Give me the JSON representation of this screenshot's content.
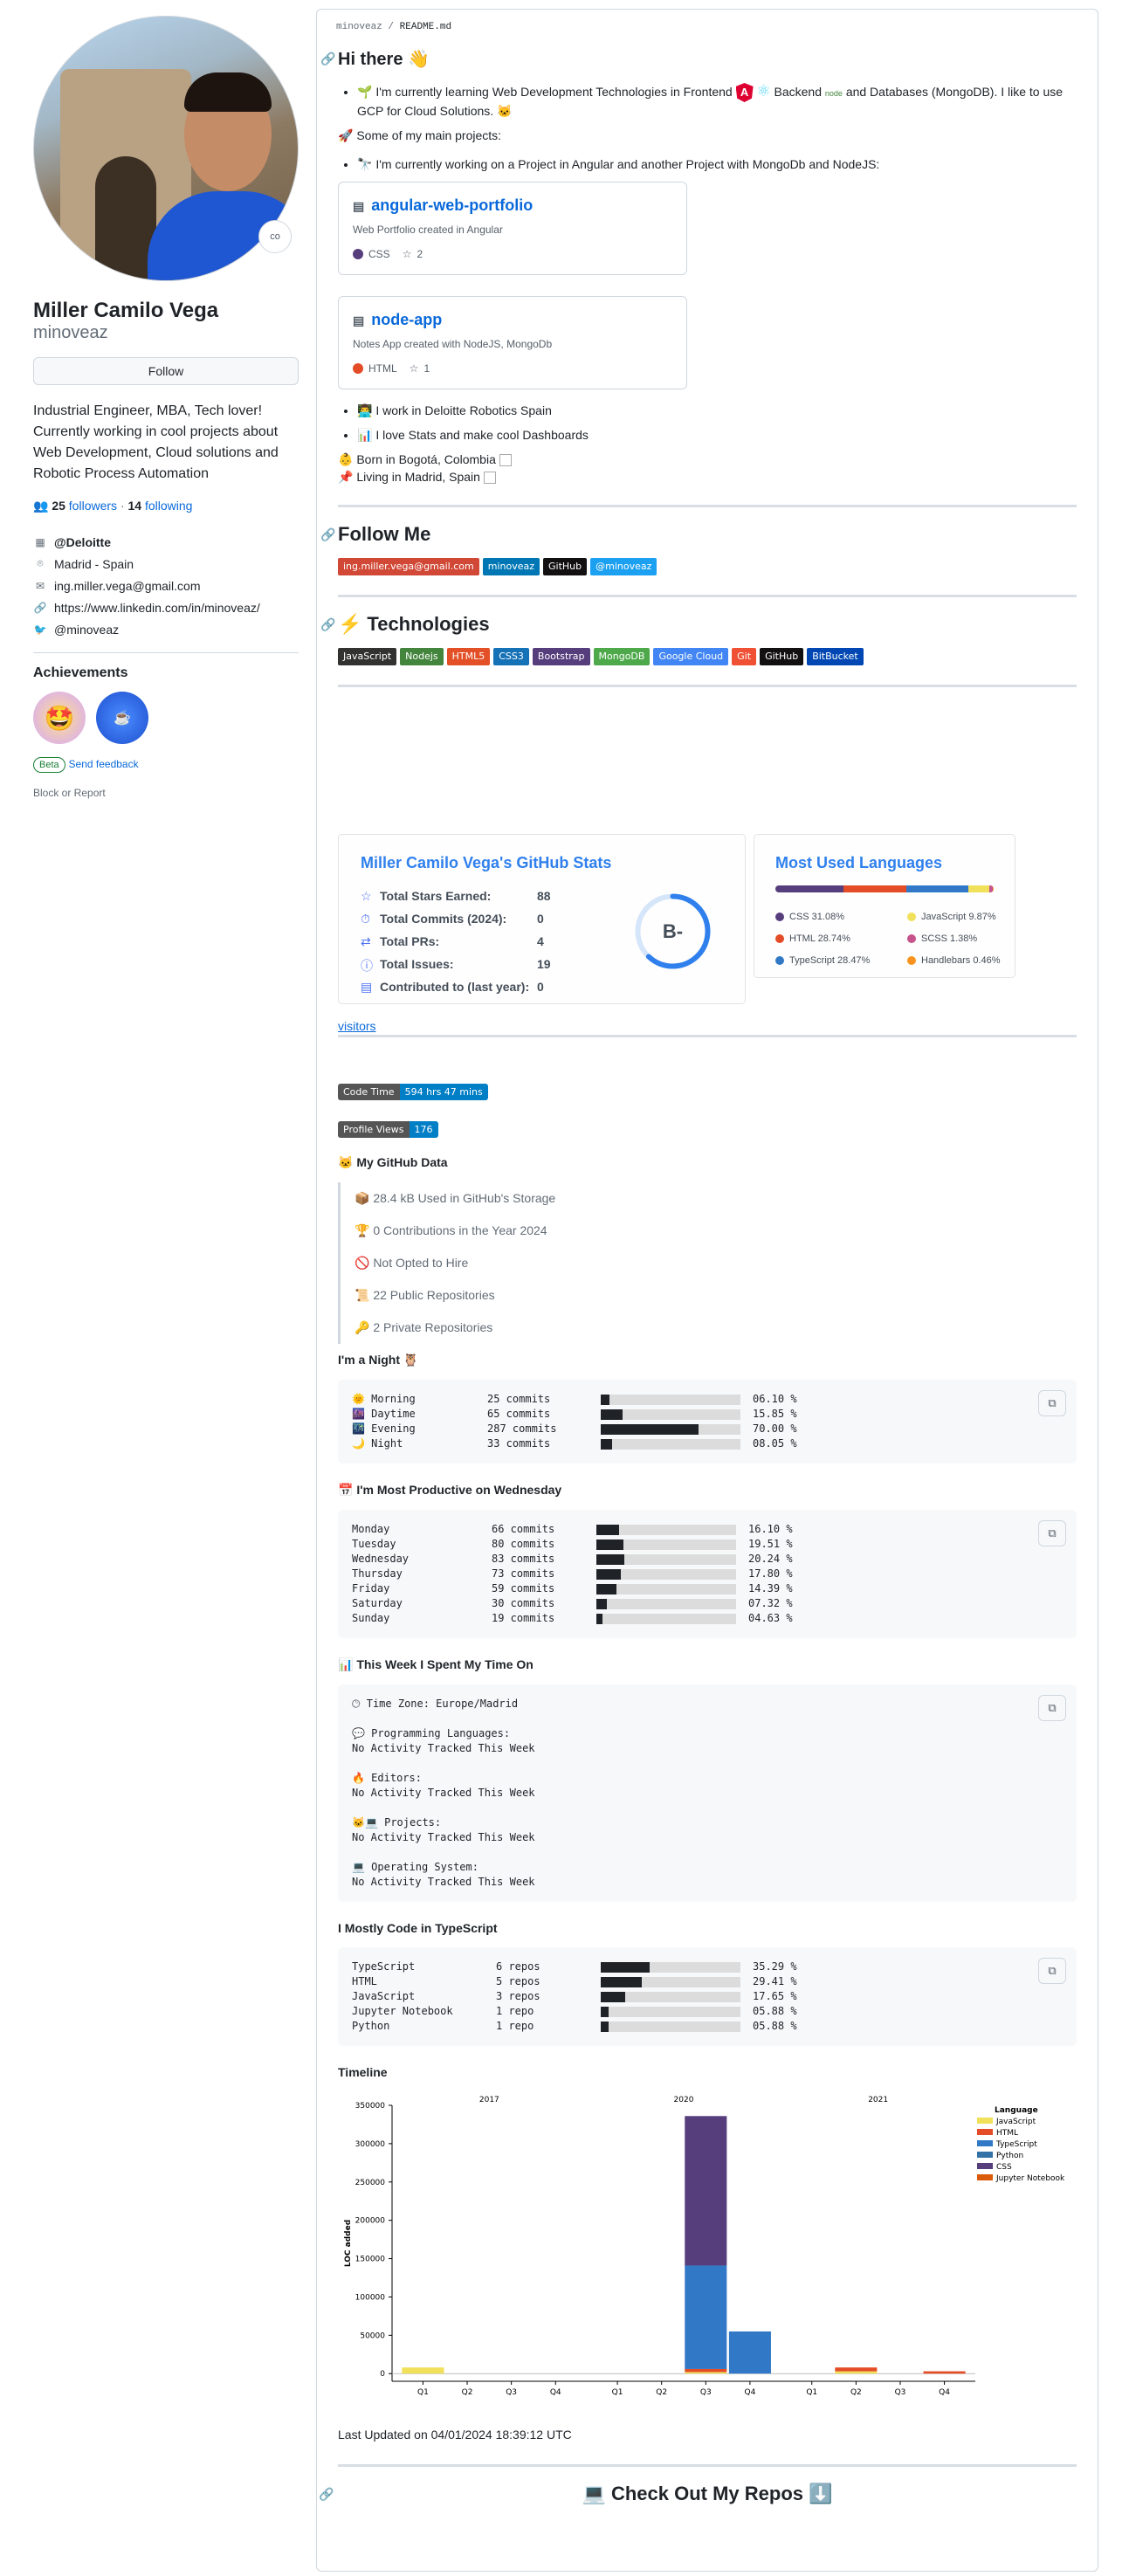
{
  "profile": {
    "name": "Miller Camilo Vega",
    "login": "minoveaz",
    "status_emoji": "co",
    "follow_label": "Follow",
    "bio": "Industrial Engineer, MBA, Tech lover! Currently working in cool projects about Web Development, Cloud solutions and Robotic Process Automation",
    "followers": "25",
    "followers_label": "followers",
    "dot": "·",
    "following": "14",
    "following_label": "following",
    "company": "@Deloitte",
    "location": "Madrid - Spain",
    "email": "ing.miller.vega@gmail.com",
    "website": "https://www.linkedin.com/in/minoveaz/",
    "twitter": "@minoveaz",
    "achievements_title": "Achievements",
    "beta_label": "Beta",
    "feedback_label": "Send feedback",
    "block_label": "Block or Report"
  },
  "readme": {
    "breadcrumb_user": "minoveaz",
    "breadcrumb_sep": "/",
    "breadcrumb_file": "README.md",
    "hi_title": "Hi there 👋",
    "learning_1": "🌱 I'm currently learning Web Development Technologies in Frontend",
    "learning_2": "Backend",
    "learning_3": "and Databases (MongoDB). I like to use GCP for Cloud Solutions.",
    "projects_intro": "🚀 Some of my main projects:",
    "working_on": "🔭 I'm currently working on a Project in Angular and another Project with MongoDb and NodeJS:",
    "repos": [
      {
        "name": "angular-web-portfolio",
        "desc": "Web Portfolio created in Angular",
        "lang": "CSS",
        "lang_color": "#563d7c",
        "stars": "2"
      },
      {
        "name": "node-app",
        "desc": "Notes App created with NodeJS, MongoDb",
        "lang": "HTML",
        "lang_color": "#e34c26",
        "stars": "1"
      }
    ],
    "work": "👨‍💻 I work in Deloitte Robotics Spain",
    "love": "📊 I love Stats and make cool Dashboards",
    "born": "👶 Born in Bogotá, Colombia",
    "living": "📌 Living in Madrid, Spain",
    "follow_title": "Follow Me",
    "follow_badges": [
      {
        "label": "ing.miller.vega@gmail.com",
        "color": "#d14836"
      },
      {
        "label": "minoveaz",
        "color": "#0077b5"
      },
      {
        "label": "GitHub",
        "color": "#121011"
      },
      {
        "label": "@minoveaz",
        "color": "#1ca0f1"
      }
    ],
    "tech_title": "Technologies",
    "tech_badges": [
      {
        "label": "JavaScript",
        "color": "#323330"
      },
      {
        "label": "Nodejs",
        "color": "#43853d"
      },
      {
        "label": "HTML5",
        "color": "#e34f26"
      },
      {
        "label": "CSS3",
        "color": "#1572b6"
      },
      {
        "label": "Bootstrap",
        "color": "#563d7c"
      },
      {
        "label": "MongoDB",
        "color": "#4ea94b"
      },
      {
        "label": "Google Cloud",
        "color": "#4285f4"
      },
      {
        "label": "Git",
        "color": "#f05033"
      },
      {
        "label": "GitHub",
        "color": "#121011"
      },
      {
        "label": "BitBucket",
        "color": "#0047b3"
      }
    ],
    "visitors_alt": "visitors",
    "code_time_label": "Code Time",
    "code_time_value": "594 hrs 47 mins",
    "profile_views_label": "Profile Views",
    "profile_views_value": "176",
    "gh_data_title": "🐱 My GitHub Data",
    "gh_data": [
      "📦 28.4 kB Used in GitHub's Storage",
      "🏆 0 Contributions in the Year 2024",
      "🚫 Not Opted to Hire",
      "📜 22 Public Repositories",
      "🔑 2 Private Repositories"
    ],
    "night_title": "I'm a Night 🦉",
    "night_rows": [
      {
        "label": "🌞 Morning",
        "commits": "25 commits",
        "pct": "06.10 %",
        "val": 6.1
      },
      {
        "label": "🌆 Daytime",
        "commits": "65 commits",
        "pct": "15.85 %",
        "val": 15.85
      },
      {
        "label": "🌃 Evening",
        "commits": "287 commits",
        "pct": "70.00 %",
        "val": 70.0
      },
      {
        "label": "🌙 Night",
        "commits": "33 commits",
        "pct": "08.05 %",
        "val": 8.05
      }
    ],
    "productive_title": "📅 I'm Most Productive on Wednesday",
    "week_rows": [
      {
        "label": "Monday",
        "commits": "66 commits",
        "pct": "16.10 %",
        "val": 16.1
      },
      {
        "label": "Tuesday",
        "commits": "80 commits",
        "pct": "19.51 %",
        "val": 19.51
      },
      {
        "label": "Wednesday",
        "commits": "83 commits",
        "pct": "20.24 %",
        "val": 20.24
      },
      {
        "label": "Thursday",
        "commits": "73 commits",
        "pct": "17.80 %",
        "val": 17.8
      },
      {
        "label": "Friday",
        "commits": "59 commits",
        "pct": "14.39 %",
        "val": 14.39
      },
      {
        "label": "Saturday",
        "commits": "30 commits",
        "pct": "07.32 %",
        "val": 7.32
      },
      {
        "label": "Sunday",
        "commits": "19 commits",
        "pct": "04.63 %",
        "val": 4.63
      }
    ],
    "this_week_title": "📊 This Week I Spent My Time On",
    "this_week_text": "🕑︎ Time Zone: Europe/Madrid\n\n💬 Programming Languages:\nNo Activity Tracked This Week\n\n🔥 Editors:\nNo Activity Tracked This Week\n\n🐱‍💻 Projects:\nNo Activity Tracked This Week\n\n💻 Operating System:\nNo Activity Tracked This Week",
    "mostly_title": "I Mostly Code in TypeScript",
    "lang_rows": [
      {
        "label": "TypeScript",
        "repos": "6 repos",
        "pct": "35.29 %",
        "val": 35.29
      },
      {
        "label": "HTML",
        "repos": "5 repos",
        "pct": "29.41 %",
        "val": 29.41
      },
      {
        "label": "JavaScript",
        "repos": "3 repos",
        "pct": "17.65 %",
        "val": 17.65
      },
      {
        "label": "Jupyter Notebook",
        "repos": "1 repo",
        "pct": "05.88 %",
        "val": 5.88
      },
      {
        "label": "Python",
        "repos": "1 repo",
        "pct": "05.88 %",
        "val": 5.88
      }
    ],
    "timeline_title": "Timeline",
    "last_updated": "Last Updated on 04/01/2024 18:39:12 UTC",
    "check_title": "💻 Check Out My Repos ⬇️"
  },
  "stats_card": {
    "title": "Miller Camilo Vega's GitHub Stats",
    "rows": [
      {
        "label": "Total Stars Earned:",
        "value": "88",
        "icon": "star-icon"
      },
      {
        "label": "Total Commits (2024):",
        "value": "0",
        "icon": "history-icon"
      },
      {
        "label": "Total PRs:",
        "value": "4",
        "icon": "pr-icon"
      },
      {
        "label": "Total Issues:",
        "value": "19",
        "icon": "issue-icon"
      },
      {
        "label": "Contributed to (last year):",
        "value": "0",
        "icon": "repo-icon"
      }
    ],
    "rank": "B-",
    "rank_progress": 0.62
  },
  "lang_card": {
    "title": "Most Used Languages",
    "langs": [
      {
        "name": "CSS 31.08%",
        "pct": 31.08,
        "color": "#563d7c"
      },
      {
        "name": "JavaScript 9.87%",
        "pct": 9.87,
        "color": "#f1e05a"
      },
      {
        "name": "HTML 28.74%",
        "pct": 28.74,
        "color": "#e34c26"
      },
      {
        "name": "SCSS 1.38%",
        "pct": 1.38,
        "color": "#c6538c"
      },
      {
        "name": "TypeScript 28.47%",
        "pct": 28.47,
        "color": "#3178c6"
      },
      {
        "name": "Handlebars 0.46%",
        "pct": 0.46,
        "color": "#f7931e"
      }
    ]
  },
  "chart_data": {
    "type": "bar",
    "title": "",
    "xlabel": "",
    "ylabel": "LOC added",
    "ylim": [
      -10000,
      350000
    ],
    "yticks": [
      0,
      50000,
      100000,
      150000,
      200000,
      250000,
      300000,
      350000
    ],
    "years": [
      "2017",
      "2020",
      "2021"
    ],
    "categories": [
      "Q1",
      "Q2",
      "Q3",
      "Q4",
      "Q1",
      "Q2",
      "Q3",
      "Q4",
      "Q1",
      "Q2",
      "Q3",
      "Q4"
    ],
    "legend_title": "Language",
    "legend_position": "top-right",
    "series": [
      {
        "name": "JavaScript",
        "color": "#f1e05a",
        "values": [
          8000,
          0,
          0,
          0,
          0,
          0,
          2000,
          0,
          0,
          3000,
          0,
          0
        ]
      },
      {
        "name": "HTML",
        "color": "#e34c26",
        "values": [
          0,
          0,
          0,
          0,
          0,
          0,
          4000,
          0,
          0,
          5000,
          0,
          3000
        ]
      },
      {
        "name": "TypeScript",
        "color": "#3178c6",
        "values": [
          0,
          0,
          0,
          0,
          0,
          0,
          135000,
          55000,
          0,
          0,
          0,
          0
        ]
      },
      {
        "name": "Python",
        "color": "#3572a5",
        "values": [
          0,
          0,
          0,
          0,
          0,
          0,
          0,
          0,
          0,
          0,
          0,
          0
        ]
      },
      {
        "name": "CSS",
        "color": "#563d7c",
        "values": [
          0,
          0,
          0,
          0,
          0,
          0,
          195000,
          0,
          0,
          0,
          0,
          0
        ]
      },
      {
        "name": "Jupyter Notebook",
        "color": "#da5b0b",
        "values": [
          0,
          0,
          0,
          0,
          0,
          0,
          0,
          0,
          0,
          0,
          0,
          0
        ]
      }
    ]
  }
}
